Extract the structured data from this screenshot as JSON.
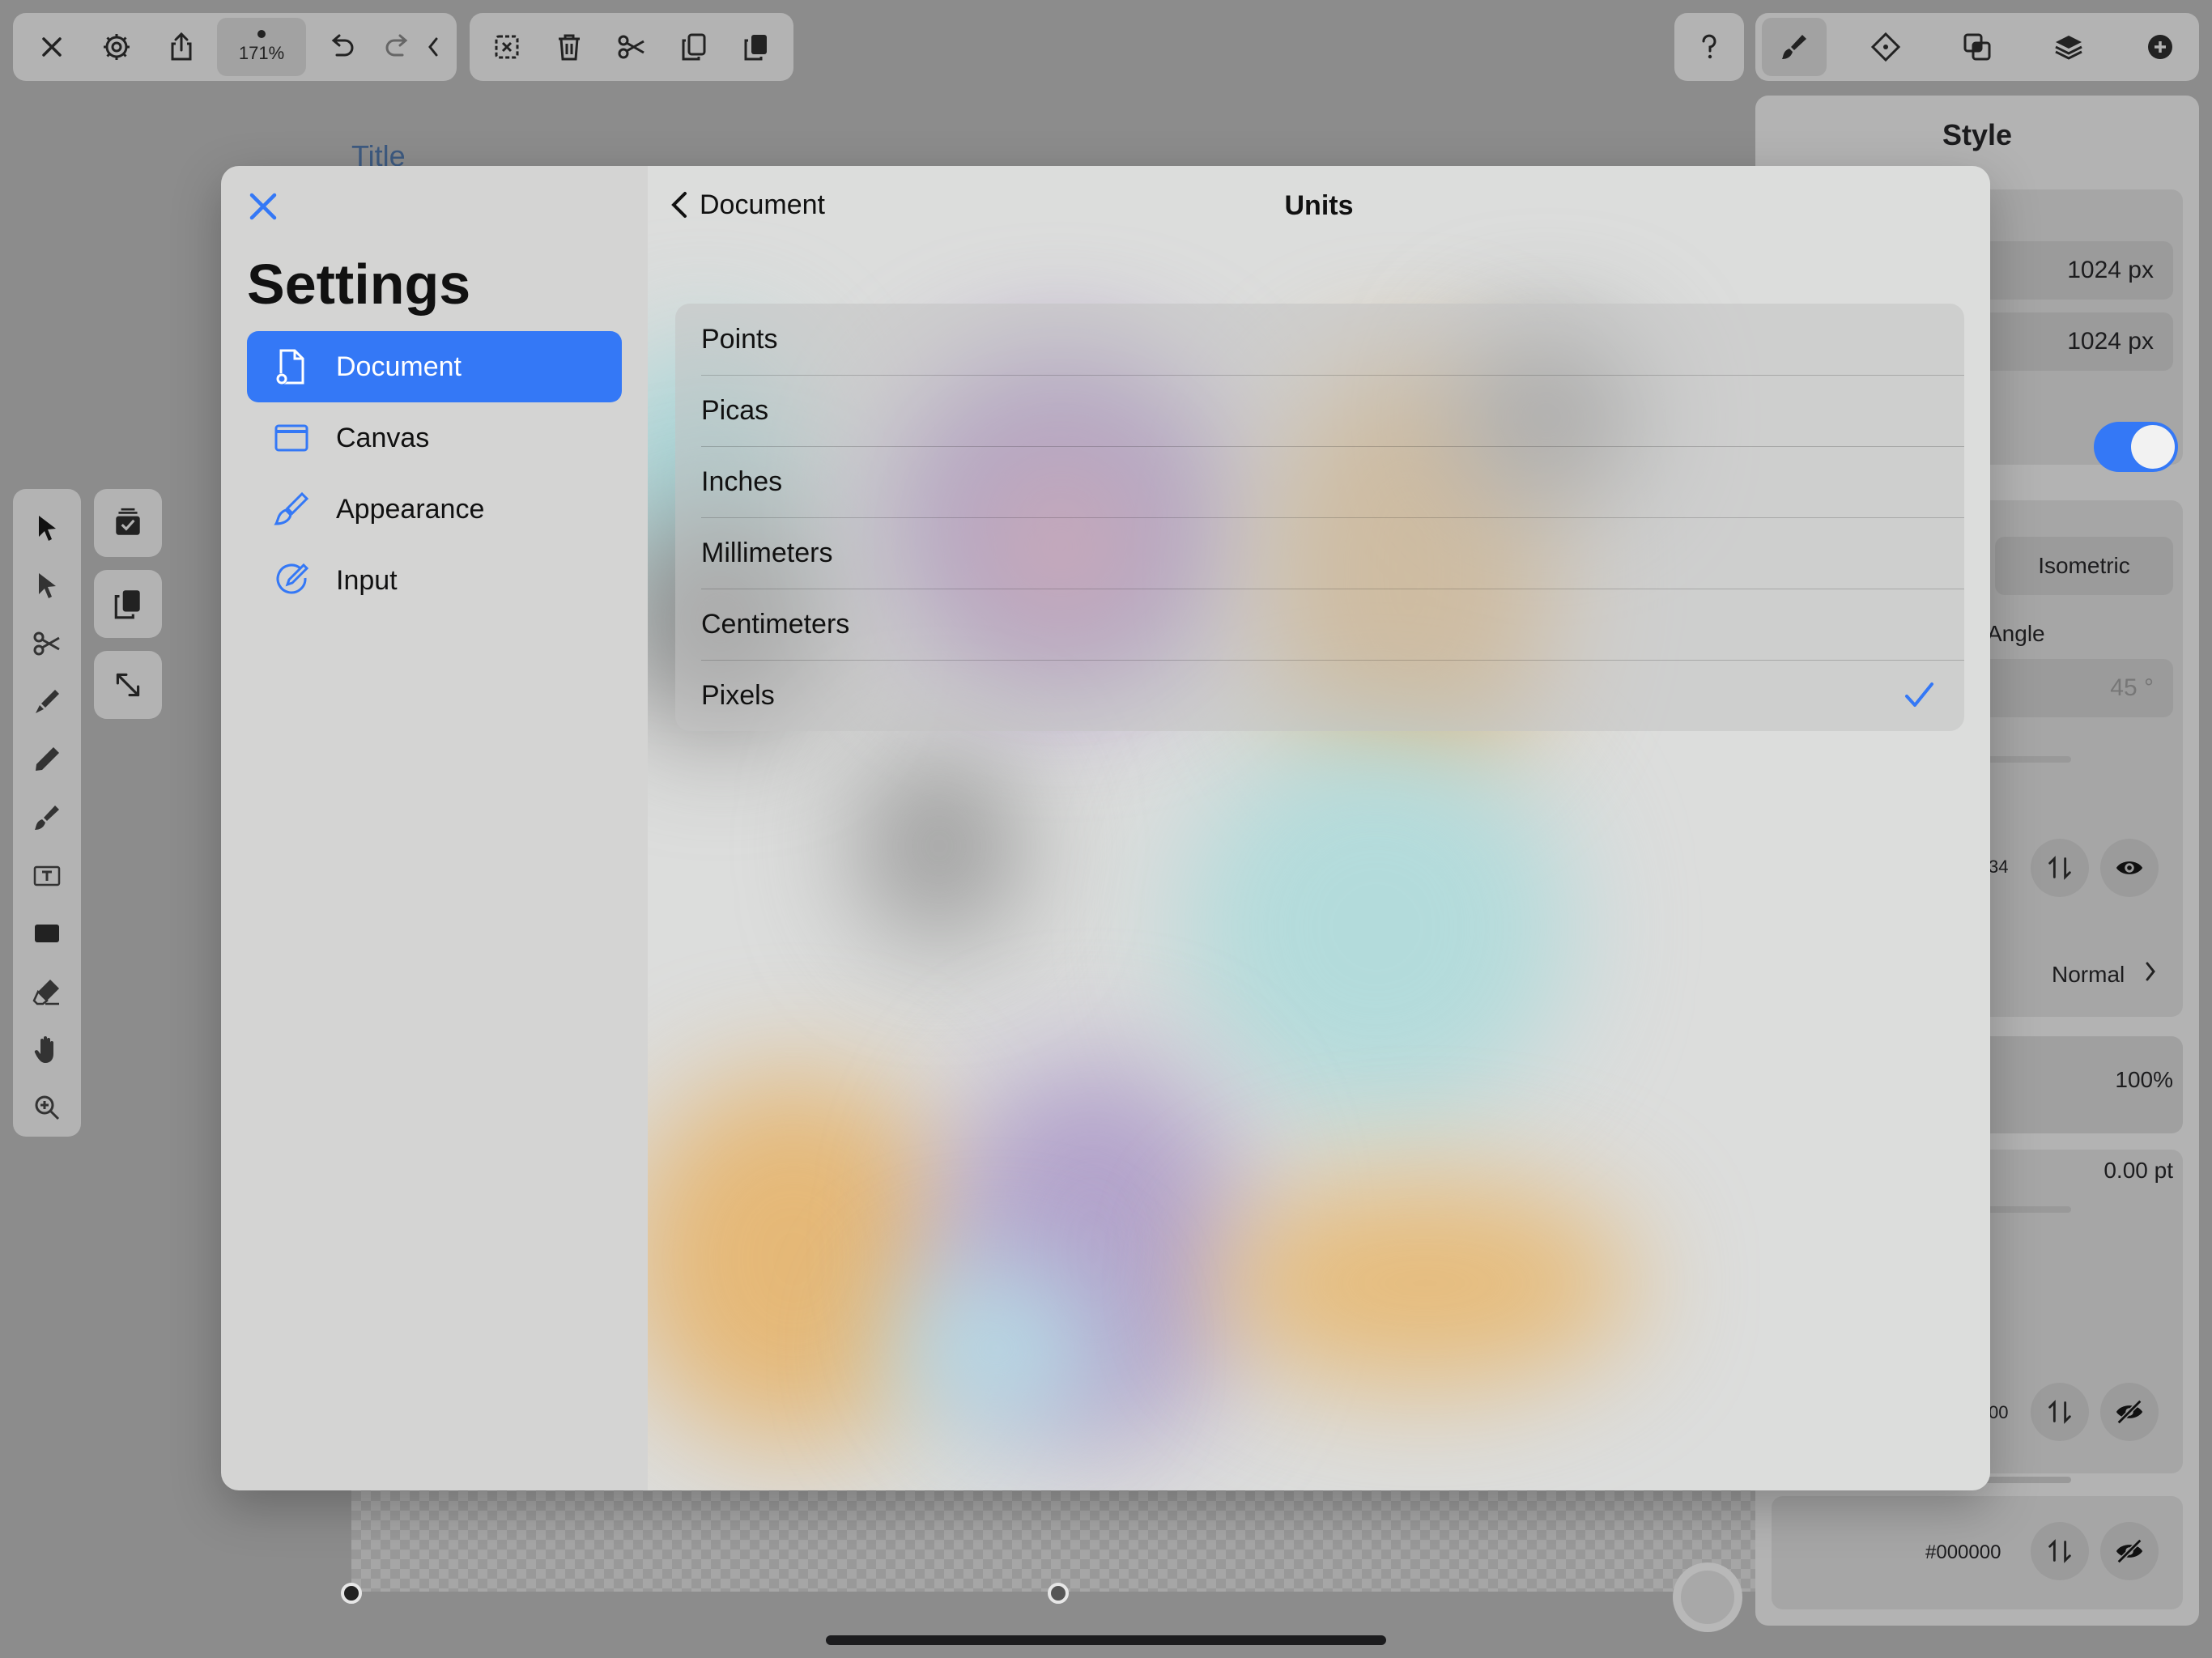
{
  "toolbar": {
    "zoom": "171%"
  },
  "canvas": {
    "title": "Title"
  },
  "style_panel": {
    "title": "Style",
    "width_value": "1024 px",
    "height_value": "1024 px",
    "grid_type": "Isometric",
    "angle_label": "Angle",
    "angle_value": "45 °",
    "fill_hex_partial": "34",
    "blend_mode": "Normal",
    "opacity": "100%",
    "stroke_width": "0.00 pt",
    "stroke_hex_partial": "00",
    "shadow_hex": "#000000"
  },
  "settings": {
    "title": "Settings",
    "sidebar": [
      {
        "label": "Document",
        "icon": "document-gear-icon",
        "selected": true
      },
      {
        "label": "Canvas",
        "icon": "canvas-window-icon",
        "selected": false
      },
      {
        "label": "Appearance",
        "icon": "paintbrush-icon",
        "selected": false
      },
      {
        "label": "Input",
        "icon": "pencil-circle-icon",
        "selected": false
      }
    ],
    "detail": {
      "back_label": "Document",
      "title": "Units",
      "options": [
        {
          "label": "Points",
          "selected": false
        },
        {
          "label": "Picas",
          "selected": false
        },
        {
          "label": "Inches",
          "selected": false
        },
        {
          "label": "Millimeters",
          "selected": false
        },
        {
          "label": "Centimeters",
          "selected": false
        },
        {
          "label": "Pixels",
          "selected": true
        }
      ]
    }
  },
  "colors": {
    "accent": "#3478f6"
  }
}
